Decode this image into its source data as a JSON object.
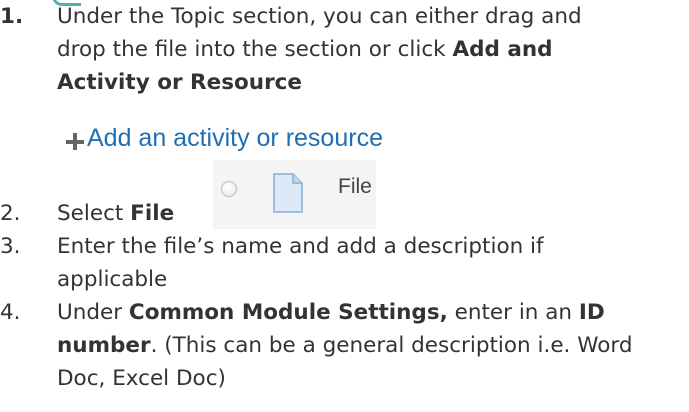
{
  "steps": [
    {
      "number": "1.",
      "lines": [
        {
          "text": "Under the Topic section, you can either drag and"
        },
        {
          "pre": "drop the file into the section or click ",
          "bold": "Add and"
        },
        {
          "bold": "Activity or Resource"
        }
      ]
    },
    {
      "number": "2.",
      "pre": "Select ",
      "bold": "File"
    },
    {
      "number": "3.",
      "line1": "Enter the file’s name and add a description if",
      "line2": "applicable"
    },
    {
      "number": "4.",
      "line1_pre": "Under ",
      "line1_bold": "Common Module Settings,",
      "line1_mid": " enter in an ",
      "line1_bold2": "ID",
      "line2_bold": "number",
      "line2_rest": ". (This can be a general description i.e. Word",
      "line3": "Doc, Excel Doc)"
    }
  ],
  "add_activity": {
    "label": "Add an activity or resource",
    "icon": "plus-icon",
    "color": "#1f6fb2"
  },
  "file_chooser": {
    "label": "File",
    "radio_icon": "radio-icon",
    "file_icon": "document-icon"
  }
}
